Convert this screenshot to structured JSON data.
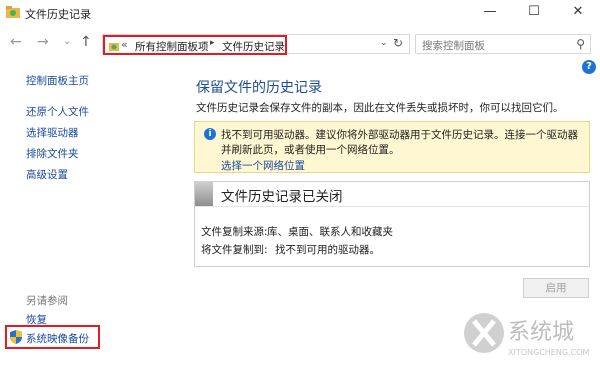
{
  "window": {
    "title": "文件历史记录",
    "minimize": "—",
    "maximize": "☐",
    "close": "✕"
  },
  "toolbar": {
    "back": "←",
    "forward": "→",
    "recent": "⌄",
    "up": "↑",
    "address": {
      "separator": "«",
      "crumb1": "所有控制面板项",
      "arrow": "▸",
      "crumb2": "文件历史记录",
      "dropdown": "⌄",
      "refresh": "↻"
    },
    "search": {
      "placeholder": "搜索控制面板",
      "icon": "⚲"
    }
  },
  "help": "?",
  "sidebar": {
    "home": "控制面板主页",
    "items": [
      "还原个人文件",
      "选择驱动器",
      "排除文件夹",
      "高级设置"
    ],
    "see_also_title": "另请参阅",
    "see_also": [
      "恢复",
      "系统映像备份"
    ]
  },
  "main": {
    "title": "保留文件的历史记录",
    "description": "文件历史记录会保存文件的副本，因此在文件丢失或损坏时，你可以找回它们。",
    "info": {
      "line1": "找不到可用驱动器。建议你将外部驱动器用于文件历史记录。连接一个驱动器",
      "line2": "并刷新此页，或者使用一个网络位置。",
      "link": "选择一个网络位置"
    },
    "status": {
      "title": "文件历史记录已关闭",
      "source_label": "文件复制来源:",
      "source_value": "库、桌面、联系人和收藏夹",
      "dest_label": "将文件复制到:",
      "dest_value": "找不到可用的驱动器。"
    },
    "enable_button": "启用"
  },
  "watermark": {
    "title": "系统城",
    "url": "XITONGCHENG.COM"
  },
  "colors": {
    "accent_blue": "#1d4d9a",
    "link": "#1a4aa0",
    "highlight_red": "#e51b23",
    "info_bg": "#fff7d1"
  }
}
